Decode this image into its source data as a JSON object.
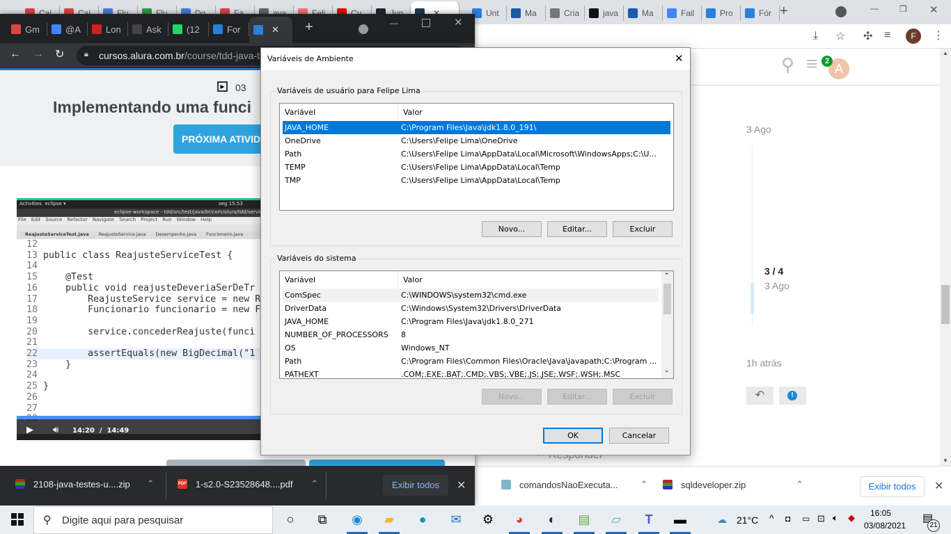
{
  "back_browser": {
    "tabs": [
      "Cai",
      "Cai",
      "Flu",
      "Flu",
      "Do",
      "Fa",
      "ava",
      "Feli",
      "Cu",
      "Jun",
      "",
      "Unt",
      "Ma",
      "Cria",
      "java",
      "Ma",
      "Fail",
      "Pro",
      "Fór"
    ],
    "profile_initial": "F",
    "page": {
      "notification_count": "2",
      "avatar_initial": "A",
      "date_top": "3 Ago",
      "progress": "3 / 4",
      "progress_date": "3 Ago",
      "last_activity": "1h atrás",
      "reply_label": "Responder"
    },
    "downloads": [
      {
        "name": "comandosNaoExecuta..."
      },
      {
        "name": "sqldeveloper.zip"
      }
    ],
    "show_all": "Exibir todos"
  },
  "front_browser": {
    "tabs": [
      "Gm",
      "@A",
      "Lon",
      "Ask",
      "(12",
      "For",
      ""
    ],
    "url_host": "cursos.alura.com.br",
    "url_path": "/course/tdd-java-t",
    "lesson": {
      "number": "03",
      "title": "Implementando uma funci",
      "next_button": "PRÓXIMA ATIVID"
    },
    "video": {
      "topbar_left": "Activities",
      "topbar_app": "eclipse ▾",
      "topbar_time": "seg 15:53",
      "window_title": "eclipse-workspace - tdd/src/test/java/br/com/alura/tdd/service/",
      "menu": [
        "File",
        "Edit",
        "Source",
        "Refactor",
        "Navigate",
        "Search",
        "Project",
        "Run",
        "Window",
        "Help"
      ],
      "editor_tabs": [
        "ReajusteServiceTest.java",
        "ReajusteService.java",
        "Desempenho.java",
        "Funcionario.java"
      ],
      "code_lines": [
        {
          "n": "12",
          "t": ""
        },
        {
          "n": "13",
          "t": "public class ReajusteServiceTest {"
        },
        {
          "n": "14",
          "t": ""
        },
        {
          "n": "15",
          "t": "    @Test"
        },
        {
          "n": "16",
          "t": "    public void reajusteDeveriaSerDeTr"
        },
        {
          "n": "17",
          "t": "        ReajusteService service = new R"
        },
        {
          "n": "18",
          "t": "        Funcionario funcionario = new F"
        },
        {
          "n": "19",
          "t": ""
        },
        {
          "n": "20",
          "t": "        service.concederReajuste(funci"
        },
        {
          "n": "21",
          "t": ""
        },
        {
          "n": "22",
          "t": "        assertEquals(new BigDecimal(\"1"
        },
        {
          "n": "23",
          "t": "    }"
        },
        {
          "n": "24",
          "t": ""
        },
        {
          "n": "25",
          "t": "}"
        },
        {
          "n": "26",
          "t": ""
        },
        {
          "n": "27",
          "t": ""
        },
        {
          "n": "28",
          "t": ""
        }
      ],
      "current_time": "14:20",
      "separator": "/",
      "duration": "14:49",
      "progress_fraction": 0.97
    },
    "downloads": [
      {
        "name": "2108-java-testes-u....zip"
      },
      {
        "name": "1-s2.0-S23528648....pdf"
      }
    ],
    "show_all": "Exibir todos"
  },
  "dialog": {
    "title": "Variáveis de Ambiente",
    "user_group": "Variáveis de usuário para Felipe Lima",
    "columns": [
      "Variável",
      "Valor"
    ],
    "user_vars": [
      {
        "name": "JAVA_HOME",
        "value": "C:\\Program Files\\Java\\jdk1.8.0_191\\"
      },
      {
        "name": "OneDrive",
        "value": "C:\\Users\\Felipe Lima\\OneDrive"
      },
      {
        "name": "Path",
        "value": "C:\\Users\\Felipe Lima\\AppData\\Local\\Microsoft\\WindowsApps;C:\\U..."
      },
      {
        "name": "TEMP",
        "value": "C:\\Users\\Felipe Lima\\AppData\\Local\\Temp"
      },
      {
        "name": "TMP",
        "value": "C:\\Users\\Felipe Lima\\AppData\\Local\\Temp"
      }
    ],
    "system_group": "Variáveis do sistema",
    "system_vars": [
      {
        "name": "ComSpec",
        "value": "C:\\WINDOWS\\system32\\cmd.exe"
      },
      {
        "name": "DriverData",
        "value": "C:\\Windows\\System32\\Drivers\\DriverData"
      },
      {
        "name": "JAVA_HOME",
        "value": "C:\\Program Files\\Java\\jdk1.8.0_271"
      },
      {
        "name": "NUMBER_OF_PROCESSORS",
        "value": "8"
      },
      {
        "name": "OS",
        "value": "Windows_NT"
      },
      {
        "name": "Path",
        "value": "C:\\Program Files\\Common Files\\Oracle\\Java\\javapath;C:\\Program ..."
      },
      {
        "name": "PATHEXT",
        "value": ".COM;.EXE;.BAT;.CMD;.VBS;.VBE;.JS;.JSE;.WSF;.WSH;.MSC"
      }
    ],
    "buttons": {
      "new": "Novo...",
      "edit": "Editar...",
      "delete": "Excluir",
      "ok": "OK",
      "cancel": "Cancelar"
    }
  },
  "taskbar": {
    "search_placeholder": "Digite aqui para pesquisar",
    "weather": "21°C",
    "time": "16:05",
    "date": "03/08/2021",
    "notifications": "21"
  }
}
